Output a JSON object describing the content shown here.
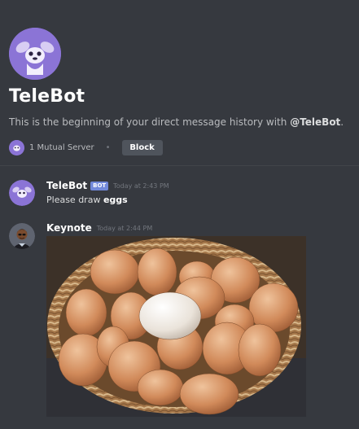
{
  "header": {
    "title": "TeleBot",
    "description_prefix": "This is the beginning of your direct message history with ",
    "description_handle": "@TeleBot",
    "description_suffix": ".",
    "mutual_servers": "1 Mutual Server",
    "separator": "•",
    "block_label": "Block"
  },
  "messages": [
    {
      "author": "TeleBot",
      "bot_tag": "BOT",
      "timestamp": "Today at 2:43 PM",
      "text_prefix": "Please draw ",
      "text_bold": "eggs"
    },
    {
      "author": "Keynote",
      "timestamp": "Today at 2:44 PM"
    }
  ],
  "colors": {
    "background": "#36393f",
    "bot_tag": "#7289da",
    "avatar_purple": "#8b74d6",
    "block_button": "#4f545c"
  },
  "icons": {
    "telebot_avatar": "stitch-avatar-icon",
    "keynote_avatar": "person-avatar-icon",
    "attachment": "egg-basket-image"
  }
}
